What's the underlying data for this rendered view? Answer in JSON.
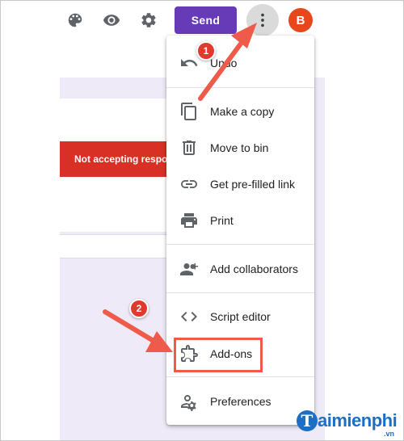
{
  "toolbar": {
    "palette_icon": "palette-icon",
    "preview_icon": "eye-icon",
    "settings_icon": "gear-icon",
    "send_label": "Send",
    "more_icon": "more-vert-icon",
    "avatar_initial": "B",
    "send_color": "#673ab7",
    "avatar_color": "#e8471d"
  },
  "background": {
    "banner_text": "Not accepting responses",
    "banner_color": "#d93025",
    "panel_color": "#eeeaf7"
  },
  "menu": {
    "items": [
      {
        "label": "Undo",
        "icon": "undo-icon"
      },
      {
        "label": "Make a copy",
        "icon": "copy-icon"
      },
      {
        "label": "Move to bin",
        "icon": "trash-icon"
      },
      {
        "label": "Get pre-filled link",
        "icon": "link-icon"
      },
      {
        "label": "Print",
        "icon": "print-icon"
      },
      {
        "label": "Add collaborators",
        "icon": "add-person-icon"
      },
      {
        "label": "Script editor",
        "icon": "code-icon"
      },
      {
        "label": "Add-ons",
        "icon": "puzzle-icon"
      },
      {
        "label": "Preferences",
        "icon": "person-settings-icon"
      }
    ]
  },
  "annotations": {
    "step1": "1",
    "step2": "2",
    "color": "#ef5b4b"
  },
  "watermark": {
    "logo_letter": "T",
    "brand": "aimienphi",
    "suffix": ".vn"
  }
}
